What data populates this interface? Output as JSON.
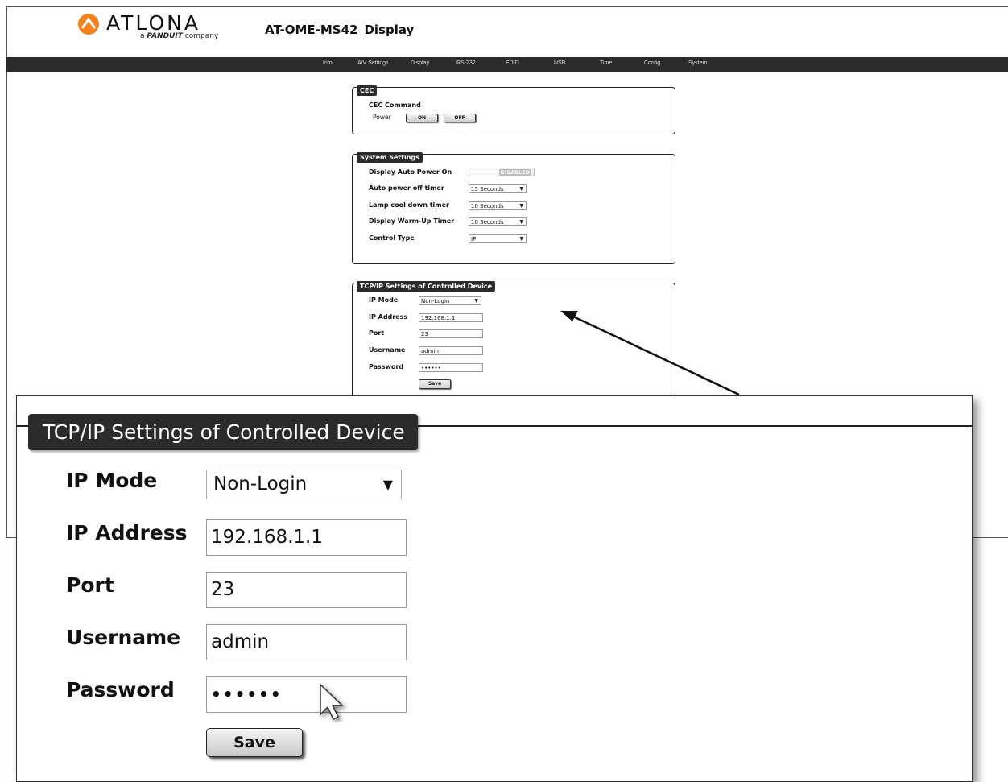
{
  "header": {
    "logo_text": "ATLONA",
    "logo_sub_prefix": "a",
    "logo_sub_brand": "PANDUIT",
    "logo_sub_suffix": "company",
    "model": "AT-OME-MS42",
    "page": "Display"
  },
  "nav": {
    "items": [
      "Info",
      "A/V Settings",
      "Display",
      "RS-232",
      "EDID",
      "USB",
      "Time",
      "Config",
      "System"
    ]
  },
  "cec": {
    "title": "CEC",
    "command_label": "CEC Command",
    "power_label": "Power",
    "on_label": "ON",
    "off_label": "OFF"
  },
  "system_settings": {
    "title": "System Settings",
    "auto_power_on_label": "Display Auto Power On",
    "auto_power_on_state": "DISABLED",
    "auto_power_off_label": "Auto power off timer",
    "auto_power_off_value": "15 Seconds",
    "lamp_cool_label": "Lamp cool down timer",
    "lamp_cool_value": "10 Seconds",
    "warmup_label": "Display Warm-Up Timer",
    "warmup_value": "10 Seconds",
    "control_type_label": "Control Type",
    "control_type_value": "IP"
  },
  "tcpip": {
    "title": "TCP/IP Settings of Controlled Device",
    "ip_mode_label": "IP Mode",
    "ip_mode_value": "Non-Login",
    "ip_address_label": "IP Address",
    "ip_address_value": "192.168.1.1",
    "port_label": "Port",
    "port_value": "23",
    "username_label": "Username",
    "username_value": "admin",
    "password_label": "Password",
    "password_value": "••••••",
    "save_label": "Save"
  },
  "icons": {
    "dropdown": "▼",
    "logo": "atlona-logo-icon",
    "cursor": "mouse-pointer-icon",
    "arrow": "callout-arrow"
  },
  "colors": {
    "navbar": "#2b2b2b",
    "logo_orange": "#f5821f",
    "title_badge": "#2b2b2b"
  }
}
